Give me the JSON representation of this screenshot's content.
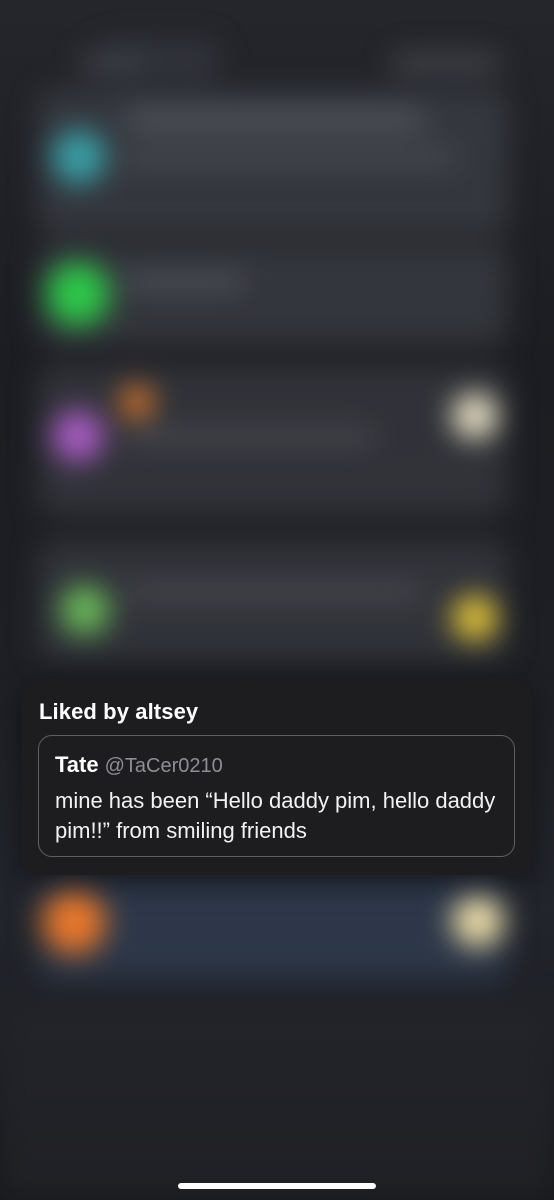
{
  "notification_card": {
    "title": "Liked by altsey",
    "tweet": {
      "author_name": "Tate",
      "author_handle": "@TaCer0210",
      "text": "mine has been “Hello daddy pim, hello daddy pim!!” from smiling friends"
    }
  },
  "colors": {
    "card_background": "#1d1d20",
    "quote_border": "#5f5f66",
    "handle_gray": "#8e8e95",
    "blurred_app_icons": [
      "#3aa0a8",
      "#2ec84a",
      "#a95cc4",
      "#6ab85a",
      "#e8782c"
    ]
  }
}
